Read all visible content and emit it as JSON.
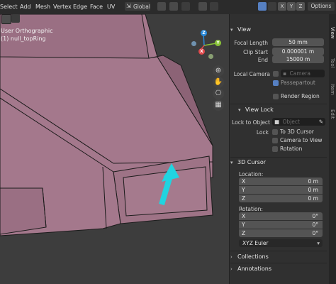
{
  "menu": [
    "Select",
    "Add",
    "Mesh",
    "Vertex",
    "Edge",
    "Face",
    "UV"
  ],
  "header": {
    "orientation": "Global",
    "axes": [
      "X",
      "Y",
      "Z"
    ],
    "options_label": "Options"
  },
  "viewport": {
    "view_name": "User Orthographic",
    "object_name": "(1) null_topRing",
    "gizmo": [
      "X",
      "Y",
      "Z"
    ]
  },
  "view_panel": {
    "title": "View",
    "focal_length_label": "Focal Length",
    "focal_length": "50 mm",
    "clip_start_label": "Clip Start",
    "clip_start": "0.000001 m",
    "clip_end_label": "End",
    "clip_end": "15000 m",
    "local_camera_label": "Local Camera",
    "camera_placeholder": "Camera",
    "passepartout_label": "Passepartout",
    "render_region_label": "Render Region"
  },
  "view_lock": {
    "title": "View Lock",
    "lock_to_object_label": "Lock to Object",
    "object_placeholder": "Object",
    "lock_label": "Lock",
    "to_3d_cursor_label": "To 3D Cursor",
    "camera_to_view_label": "Camera to View",
    "rotation_label": "Rotation"
  },
  "cursor_panel": {
    "title": "3D Cursor",
    "location_label": "Location:",
    "location": [
      {
        "axis": "X",
        "value": "0 m"
      },
      {
        "axis": "Y",
        "value": "0 m"
      },
      {
        "axis": "Z",
        "value": "0 m"
      }
    ],
    "rotation_label": "Rotation:",
    "rotation": [
      {
        "axis": "X",
        "value": "0°"
      },
      {
        "axis": "Y",
        "value": "0°"
      },
      {
        "axis": "Z",
        "value": "0°"
      }
    ],
    "rotation_mode": "XYZ Euler"
  },
  "collections_label": "Collections",
  "annotations_label": "Annotations",
  "sidebar_tabs": [
    "View",
    "Tool",
    "Item",
    "Edit"
  ],
  "colors": {
    "mesh_face": "#a4788c",
    "mesh_edge": "#1b1b1b",
    "arrow": "#20d4e0",
    "accent": "#5680c2"
  }
}
